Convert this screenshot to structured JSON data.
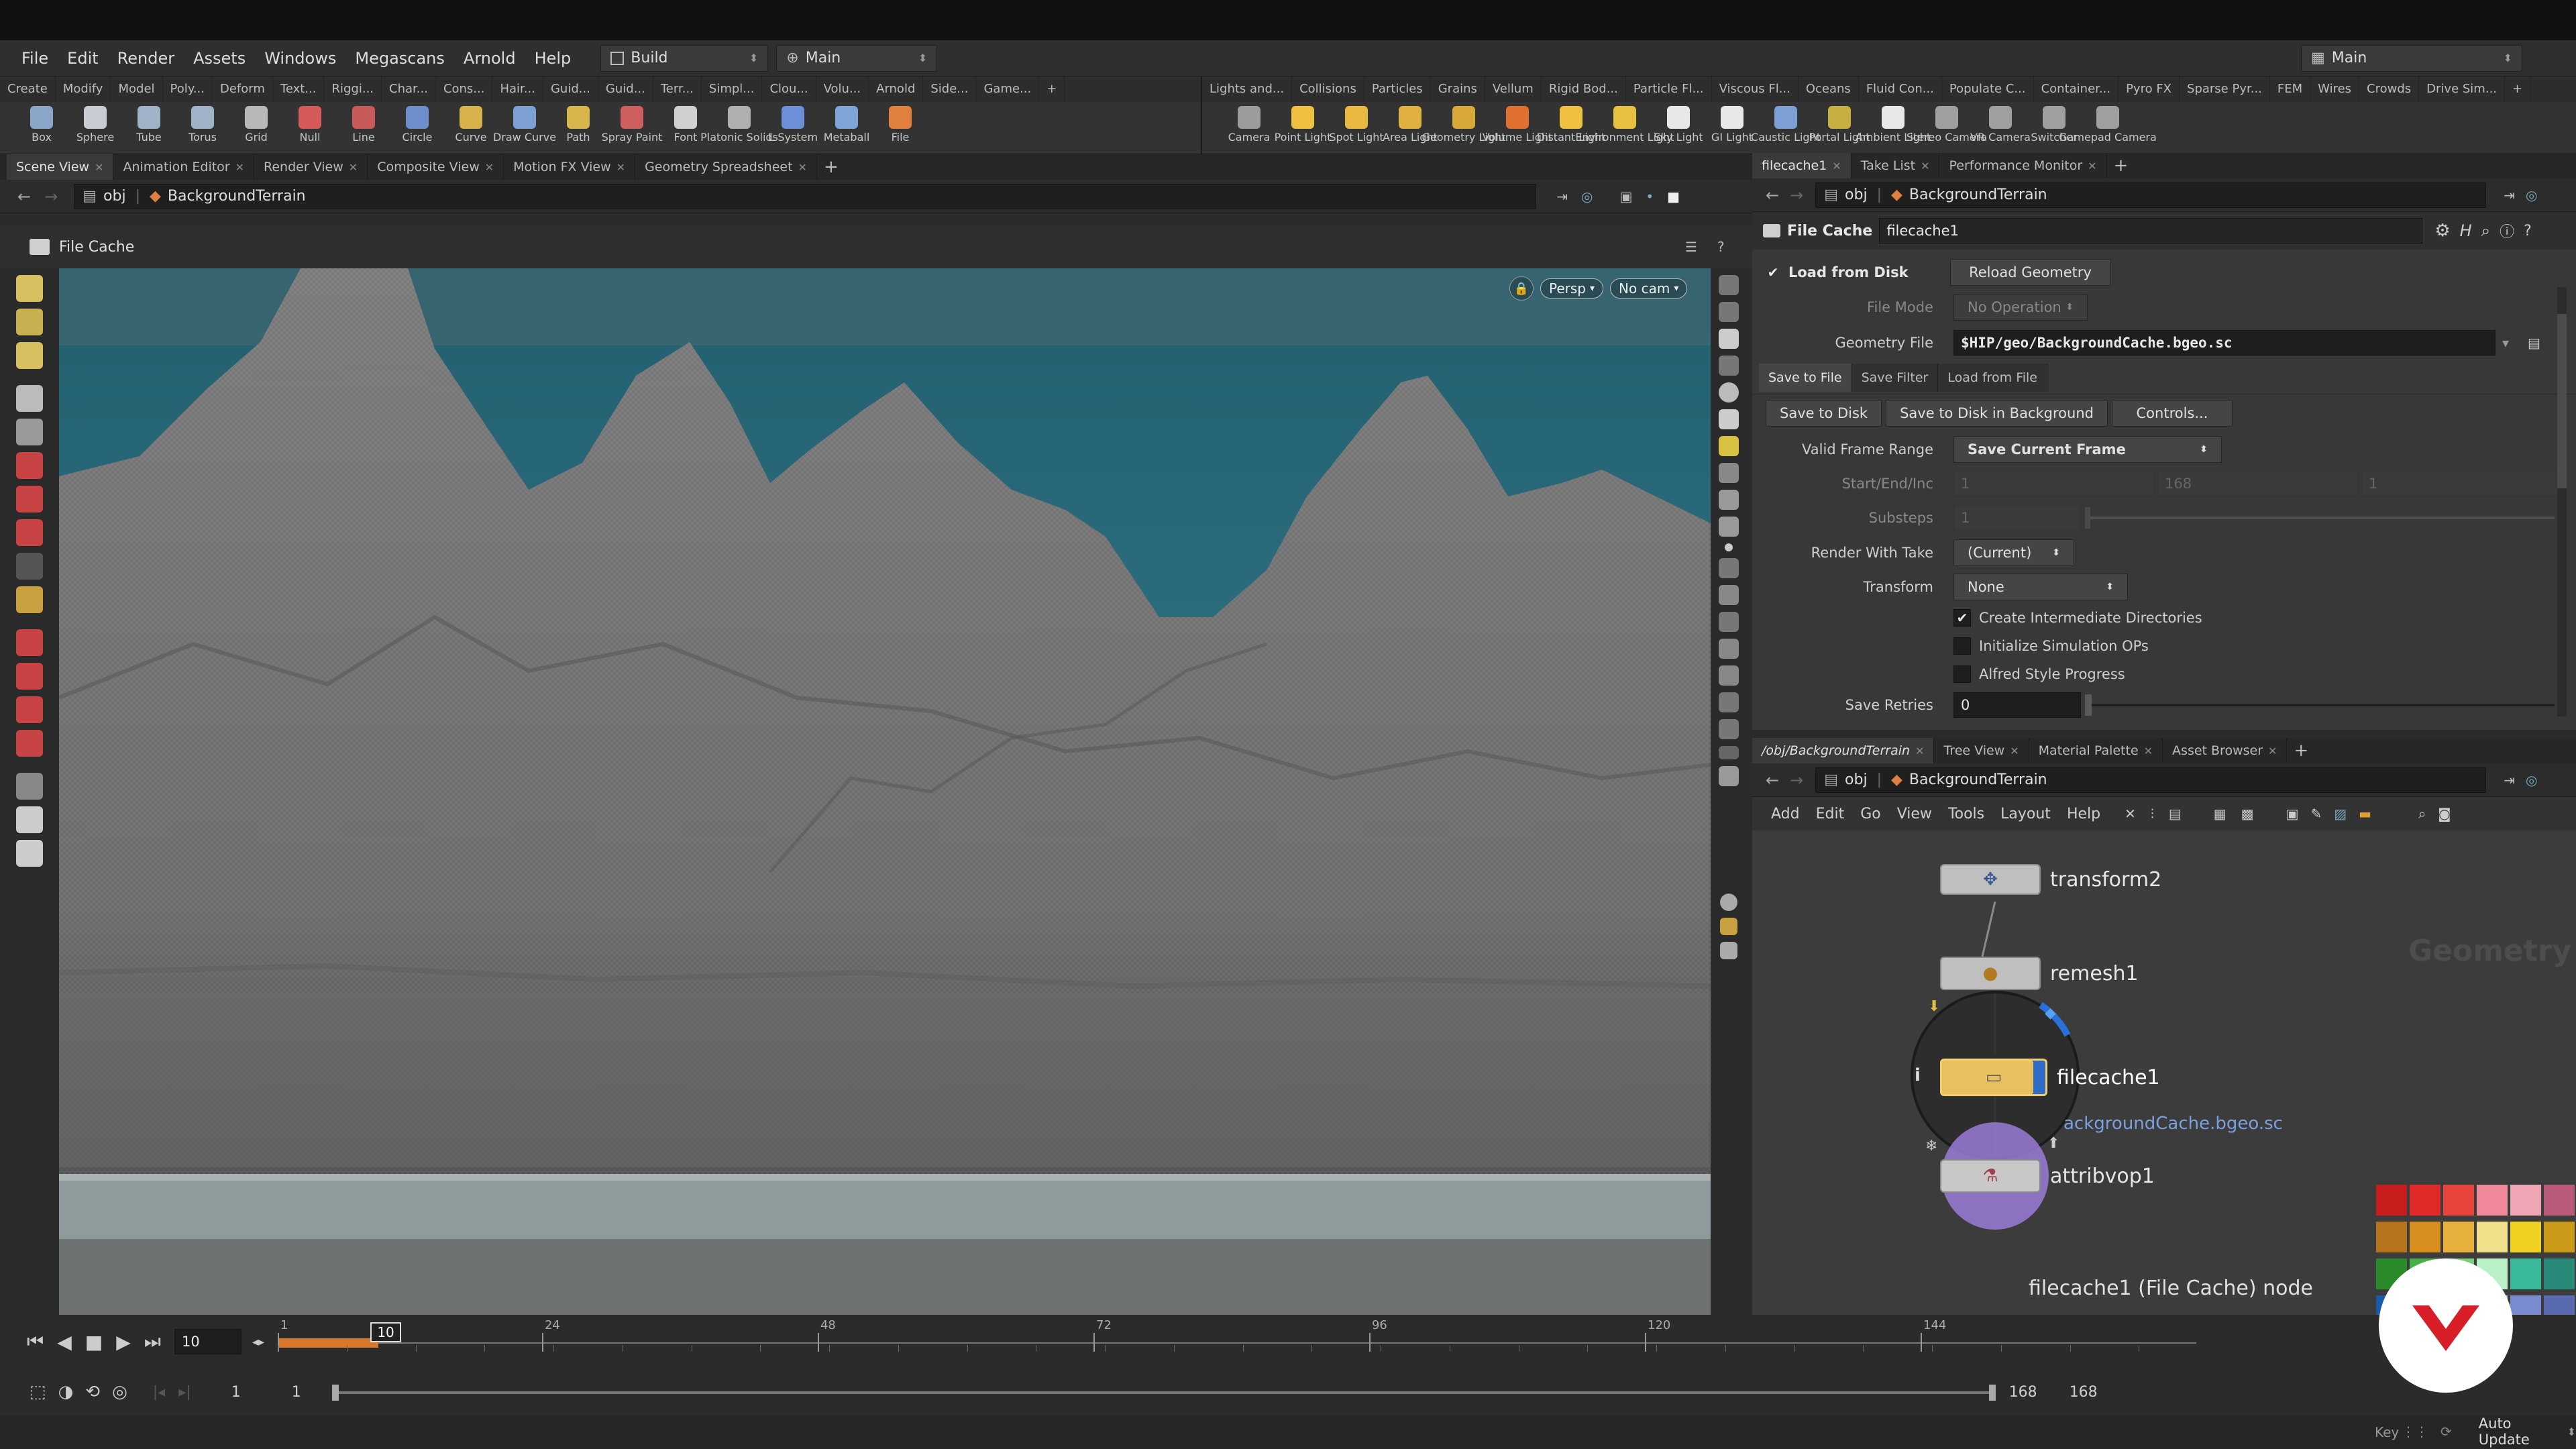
{
  "menubar": {
    "items": [
      "File",
      "Edit",
      "Render",
      "Assets",
      "Windows",
      "Megascans",
      "Arnold",
      "Help"
    ],
    "desktop": "Build",
    "context": "Main",
    "right_context": "Main"
  },
  "shelf_tabs_left": [
    "Create",
    "Modify",
    "Model",
    "Poly...",
    "Deform",
    "Text...",
    "Riggi...",
    "Char...",
    "Cons...",
    "Hair...",
    "Guid...",
    "Guid...",
    "Terr...",
    "Simpl...",
    "Clou...",
    "Volu...",
    "Arnold",
    "Side...",
    "Game..."
  ],
  "shelf_tabs_right": [
    "Lights and...",
    "Collisions",
    "Particles",
    "Grains",
    "Vellum",
    "Rigid Bod...",
    "Particle Fl...",
    "Viscous Fl...",
    "Oceans",
    "Fluid Con...",
    "Populate C...",
    "Container...",
    "Pyro FX",
    "Sparse Pyr...",
    "FEM",
    "Wires",
    "Crowds",
    "Drive Sim..."
  ],
  "shelf_tools_left": [
    {
      "label": "Box",
      "icon": "box-icon",
      "color": "#8aa6c8"
    },
    {
      "label": "Sphere",
      "icon": "sphere-icon",
      "color": "#c9cdd3"
    },
    {
      "label": "Tube",
      "icon": "tube-icon",
      "color": "#9fb2c8"
    },
    {
      "label": "Torus",
      "icon": "torus-icon",
      "color": "#9fb2c8"
    },
    {
      "label": "Grid",
      "icon": "grid-icon",
      "color": "#b8b8b8"
    },
    {
      "label": "Null",
      "icon": "null-icon",
      "color": "#d65a5a"
    },
    {
      "label": "Line",
      "icon": "line-icon",
      "color": "#c85a5a"
    },
    {
      "label": "Circle",
      "icon": "circle-icon",
      "color": "#6e8ecb"
    },
    {
      "label": "Curve",
      "icon": "curve-icon",
      "color": "#d9b24b"
    },
    {
      "label": "Draw Curve",
      "icon": "draw-curve-icon",
      "color": "#7c9fd4"
    },
    {
      "label": "Path",
      "icon": "path-icon",
      "color": "#d8b64c"
    },
    {
      "label": "Spray Paint",
      "icon": "spray-paint-icon",
      "color": "#cf5f5f"
    },
    {
      "label": "Font",
      "icon": "font-icon",
      "color": "#d0d0d0"
    },
    {
      "label": "Platonic Solids",
      "icon": "platonic-solids-icon",
      "color": "#b0b0b0"
    },
    {
      "label": "L-System",
      "icon": "l-system-icon",
      "color": "#6c8fd8"
    },
    {
      "label": "Metaball",
      "icon": "metaball-icon",
      "color": "#7fa5d8"
    },
    {
      "label": "File",
      "icon": "file-icon",
      "color": "#e0803c"
    }
  ],
  "shelf_tools_right": [
    {
      "label": "Camera",
      "icon": "camera-icon",
      "color": "#9c9c9c"
    },
    {
      "label": "Point Light",
      "icon": "point-light-icon",
      "color": "#f0c040"
    },
    {
      "label": "Spot Light",
      "icon": "spot-light-icon",
      "color": "#e8b840"
    },
    {
      "label": "Area Light",
      "icon": "area-light-icon",
      "color": "#e0b040"
    },
    {
      "label": "Geometry Light",
      "icon": "geometry-light-icon",
      "color": "#d8a838"
    },
    {
      "label": "Volume Light",
      "icon": "volume-light-icon",
      "color": "#e07030"
    },
    {
      "label": "Distant Light",
      "icon": "distant-light-icon",
      "color": "#f0c040"
    },
    {
      "label": "Environment Light",
      "icon": "environment-light-icon",
      "color": "#e8c040"
    },
    {
      "label": "Sky Light",
      "icon": "sky-light-icon",
      "color": "#e8e8e8"
    },
    {
      "label": "GI Light",
      "icon": "gi-light-icon",
      "color": "#e8e8e8"
    },
    {
      "label": "Caustic Light",
      "icon": "caustic-light-icon",
      "color": "#7c9fd4"
    },
    {
      "label": "Portal Light",
      "icon": "portal-light-icon",
      "color": "#c8b040"
    },
    {
      "label": "Ambient Light",
      "icon": "ambient-light-icon",
      "color": "#e8e8e8"
    },
    {
      "label": "Stereo Camera",
      "icon": "stereo-camera-icon",
      "color": "#a0a0a0"
    },
    {
      "label": "VR Camera",
      "icon": "vr-camera-icon",
      "color": "#a0a0a0"
    },
    {
      "label": "Switcher",
      "icon": "switcher-icon",
      "color": "#a0a0a0"
    },
    {
      "label": "Gamepad Camera",
      "icon": "gamepad-camera-icon",
      "color": "#a0a0a0"
    }
  ],
  "left_pane_tabs": [
    "Scene View",
    "Animation Editor",
    "Render View",
    "Composite View",
    "Motion FX View",
    "Geometry Spreadsheet"
  ],
  "left_path": {
    "root": "obj",
    "node": "BackgroundTerrain"
  },
  "viewport": {
    "title": "File Cache",
    "view_mode": "Persp",
    "camera": "No cam",
    "sky_color": "#2f6f7e",
    "ground_color": "#9aa8aa"
  },
  "param_pane": {
    "tabs": [
      "filecache1",
      "Take List",
      "Performance Monitor"
    ],
    "path_root": "obj",
    "path_node": "BackgroundTerrain",
    "node_type": "File Cache",
    "node_name": "filecache1",
    "load_from_disk_label": "Load from Disk",
    "load_from_disk_checked": true,
    "reload_geometry": "Reload Geometry",
    "file_mode_label": "File Mode",
    "file_mode_value": "No Operation",
    "geometry_file_label": "Geometry File",
    "geometry_file_value": "$HIP/geo/BackgroundCache.bgeo.sc",
    "sub_tabs": [
      "Save to File",
      "Save Filter",
      "Load from File"
    ],
    "save_to_disk": "Save to Disk",
    "save_bg": "Save to Disk in Background",
    "controls": "Controls...",
    "valid_frame_range_label": "Valid Frame Range",
    "valid_frame_range_value": "Save Current Frame",
    "start_end_inc_label": "Start/End/Inc",
    "start_value": "1",
    "end_value": "168",
    "inc_value": "1",
    "substeps_label": "Substeps",
    "substeps_value": "1",
    "render_with_take_label": "Render With Take",
    "render_with_take_value": "(Current)",
    "transform_label": "Transform",
    "transform_value": "None",
    "checks": [
      {
        "label": "Create Intermediate Directories",
        "checked": true
      },
      {
        "label": "Initialize Simulation OPs",
        "checked": false
      },
      {
        "label": "Alfred Style Progress",
        "checked": false
      }
    ],
    "save_retries_label": "Save Retries",
    "save_retries_value": "0"
  },
  "network_pane": {
    "tabs": [
      "/obj/BackgroundTerrain",
      "Tree View",
      "Material Palette",
      "Asset Browser"
    ],
    "path_root": "obj",
    "path_node": "BackgroundTerrain",
    "menu": [
      "Add",
      "Edit",
      "Go",
      "View",
      "Tools",
      "Layout",
      "Help"
    ],
    "watermark": "Geometry",
    "nodes": [
      {
        "name": "transform2"
      },
      {
        "name": "remesh1"
      },
      {
        "name": "filecache1"
      },
      {
        "name": "attribvop1"
      }
    ],
    "file_hint": "ackgroundCache.bgeo.sc",
    "info_label": "i",
    "status": "filecache1 (File Cache) node",
    "palette": [
      "#c81d1d",
      "#e02a2a",
      "#e8453f",
      "#f08a9a",
      "#f0a5b5",
      "#b85a78",
      "#b8741c",
      "#d68e1c",
      "#e8b03c",
      "#f0e08a",
      "#f0d020",
      "#c89a18",
      "#2a8a2a",
      "#48b048",
      "#7ad07a",
      "#b8f0c8",
      "#3ab89a",
      "#2a8a7a",
      "#1a5aa8",
      "#2a78d8",
      "#6aa8f0",
      "#a8c8f0",
      "#7a8ad0",
      "#5a6ab0",
      "#4a3a98",
      "#6a4ab8",
      "#9a6ad0",
      "#d07ad0",
      "#a84aa8",
      "#7a2a7a",
      "#111111",
      "#3a3a3a",
      "#6a6a6a",
      "#9a9a9a",
      "#cacaca",
      "#f4f4f4"
    ]
  },
  "timeline": {
    "current_frame": "10",
    "ticks": [
      "1",
      "24",
      "48",
      "72",
      "96",
      "120",
      "144"
    ],
    "start_a": "1",
    "start_b": "1",
    "end_a": "168",
    "end_b": "168",
    "key_label": "Key",
    "auto_update": "Auto Update"
  }
}
